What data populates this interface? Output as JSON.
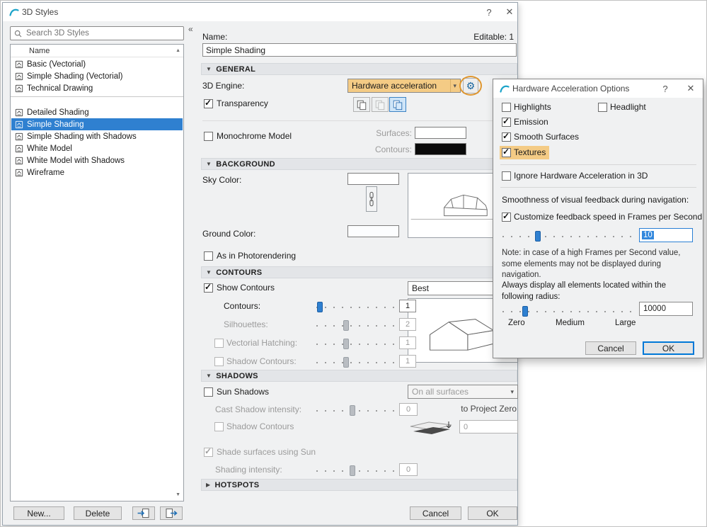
{
  "window": {
    "title": "3D Styles",
    "editable_info": "Editable: 1"
  },
  "icons": {
    "help": "?",
    "close": "✕",
    "section_expanded": "▼",
    "section_collapsed": "▶",
    "combo_arrow": "▾",
    "gear": "⚙",
    "scroll_up": "▲",
    "scroll_down": "▼",
    "collapse_panel": "«"
  },
  "sidebar": {
    "search_placeholder": "Search 3D Styles",
    "header": "Name",
    "default_styles": [
      "Basic (Vectorial)",
      "Simple Shading (Vectorial)",
      "Technical Drawing"
    ],
    "custom_styles": [
      "Detailed Shading",
      "Simple Shading",
      "Simple Shading with Shadows",
      "White Model",
      "White Model with Shadows",
      "Wireframe"
    ],
    "selected_style": "Simple Shading",
    "new_label": "New...",
    "delete_label": "Delete"
  },
  "editor": {
    "name_label": "Name:",
    "style_name": "Simple Shading",
    "general": {
      "header": "GENERAL",
      "engine_label": "3D Engine:",
      "engine_value": "Hardware acceleration",
      "transparency": "Transparency",
      "monochrome": "Monochrome Model",
      "surfaces_label": "Surfaces:",
      "contours_label": "Contours:"
    },
    "background": {
      "header": "BACKGROUND",
      "sky_label": "Sky Color:",
      "ground_label": "Ground Color:",
      "photorendering": "As in Photorendering"
    },
    "contours": {
      "header": "CONTOURS",
      "show_contours": "Show Contours",
      "quality": "Best",
      "contours_label": "Contours:",
      "contours_value": "1",
      "silhouettes_label": "Silhouettes:",
      "silhouettes_value": "2",
      "hatching_label": "Vectorial Hatching:",
      "hatching_value": "1",
      "shadow_label": "Shadow Contours:",
      "shadow_value": "1"
    },
    "shadows": {
      "header": "SHADOWS",
      "sun_shadows": "Sun Shadows",
      "surface_mode": "On all surfaces",
      "cast_label": "Cast Shadow intensity:",
      "cast_value": "0",
      "project_zero": "to Project Zero",
      "shadow_contours": "Shadow Contours",
      "shadow_contours_value": "0",
      "shade_label": "Shade surfaces using Sun",
      "intensity_label": "Shading intensity:",
      "intensity_value": "0"
    },
    "hotspots": {
      "header": "HOTSPOTS"
    },
    "cancel_label": "Cancel",
    "ok_label": "OK"
  },
  "hw_dialog": {
    "title": "Hardware Acceleration Options",
    "highlights": "Highlights",
    "headlight": "Headlight",
    "emission": "Emission",
    "smooth_surfaces": "Smooth Surfaces",
    "textures": "Textures",
    "ignore": "Ignore Hardware Acceleration in 3D",
    "smoothness_label": "Smoothness of visual feedback during navigation:",
    "customize_label": "Customize feedback speed in Frames per Second",
    "fps_value": "10",
    "note": "Note: in case of a high Frames per Second value, some elements may not be displayed during navigation.",
    "radius_label": "Always display all elements located within the following radius:",
    "zero": "Zero",
    "medium": "Medium",
    "large": "Large",
    "radius_value": "10000",
    "cancel_label": "Cancel",
    "ok_label": "OK"
  },
  "colors": {
    "selection_blue": "#2f80d0",
    "highlight_orange": "#f4cb85",
    "accent_blue": "#0078d7"
  }
}
